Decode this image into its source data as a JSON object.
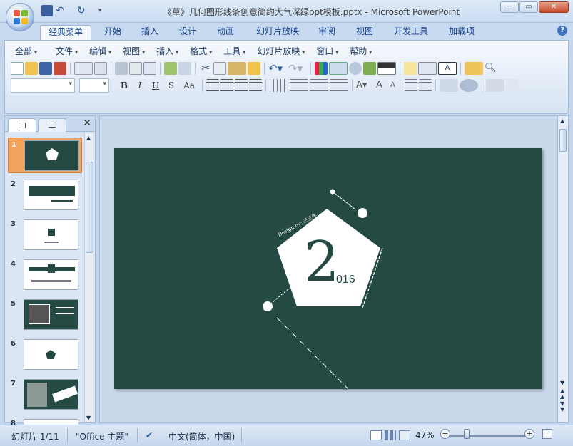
{
  "window": {
    "title": "《草》几何图形线条创意简约大气深绿ppt模板.pptx - Microsoft PowerPoint",
    "controls": [
      "─",
      "▭",
      "✕"
    ]
  },
  "tabs": [
    {
      "label": "经典菜单",
      "active": true
    },
    {
      "label": "开始"
    },
    {
      "label": "插入"
    },
    {
      "label": "设计"
    },
    {
      "label": "动画"
    },
    {
      "label": "幻灯片放映"
    },
    {
      "label": "审阅"
    },
    {
      "label": "视图"
    },
    {
      "label": "开发工具"
    },
    {
      "label": "加载项"
    }
  ],
  "help": "?",
  "menus": [
    "全部",
    "文件",
    "编辑",
    "视图",
    "插入",
    "格式",
    "工具",
    "幻灯片放映",
    "窗口",
    "帮助"
  ],
  "format_buttons": [
    "B",
    "I",
    "U",
    "S",
    "Aa"
  ],
  "panel": {
    "tabs": [
      "slides",
      "outline"
    ],
    "slides": [
      1,
      2,
      3,
      4,
      5,
      6,
      7,
      8
    ]
  },
  "slide": {
    "big_digit": "2",
    "year_rest": "016",
    "design_by": "Design by: 三三年",
    "colors": {
      "background": "#244a43",
      "shape": "#ffffff",
      "digit": "#244a43"
    }
  },
  "status": {
    "slide_info": "幻灯片 1/11",
    "theme": "\"Office 主题\"",
    "language": "中文(简体，中国)",
    "zoom": "47%",
    "zoom_fraction": 0.47
  }
}
